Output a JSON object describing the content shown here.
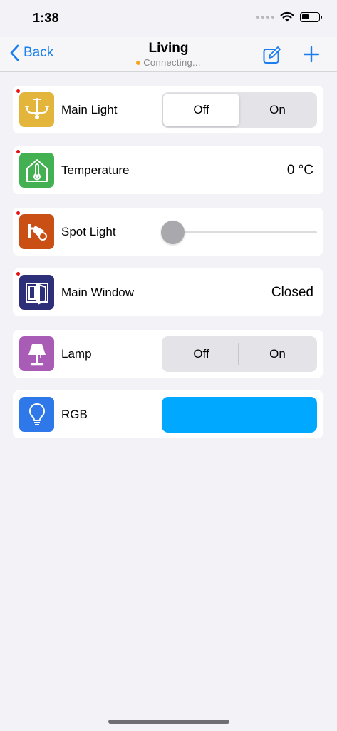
{
  "status_bar": {
    "time": "1:38"
  },
  "nav": {
    "back_label": "Back",
    "title": "Living",
    "subtitle": "Connecting...",
    "accent": "#1a7ef0",
    "connecting_dot_color": "#f5a623"
  },
  "devices": [
    {
      "label": "Main Light",
      "icon": "chandelier-icon",
      "icon_color": "#e3b53b",
      "alert_dot": true,
      "control": "segmented",
      "options": [
        "Off",
        "On"
      ],
      "selected": "Off"
    },
    {
      "label": "Temperature",
      "icon": "thermometer-house-icon",
      "icon_color": "#43b152",
      "alert_dot": true,
      "control": "value",
      "value": "0 °C"
    },
    {
      "label": "Spot Light",
      "icon": "spotlight-icon",
      "icon_color": "#c94f14",
      "alert_dot": true,
      "control": "slider",
      "level": 0
    },
    {
      "label": "Main Window",
      "icon": "window-icon",
      "icon_color": "#2d2f79",
      "alert_dot": true,
      "control": "value",
      "value": "Closed"
    },
    {
      "label": "Lamp",
      "icon": "lamp-icon",
      "icon_color": "#a95cb6",
      "alert_dot": false,
      "control": "segmented",
      "options": [
        "Off",
        "On"
      ],
      "selected": null
    },
    {
      "label": "RGB",
      "icon": "bulb-icon",
      "icon_color": "#2e78ea",
      "alert_dot": false,
      "control": "color",
      "color": "#00a8ff"
    }
  ]
}
